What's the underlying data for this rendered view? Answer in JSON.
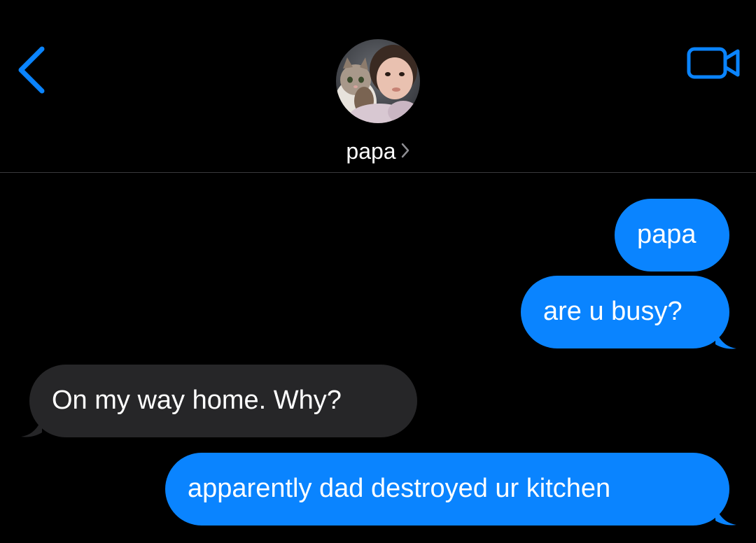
{
  "header": {
    "contact_name": "papa",
    "icons": {
      "back": "chevron-left-icon",
      "video": "video-camera-icon",
      "name_chevron": "chevron-right-icon"
    }
  },
  "messages": [
    {
      "direction": "sent",
      "text": "papa"
    },
    {
      "direction": "sent",
      "text": "are u busy?"
    },
    {
      "direction": "received",
      "text": "On my way home. Why?"
    },
    {
      "direction": "sent",
      "text": "apparently dad destroyed ur kitchen"
    }
  ],
  "colors": {
    "accent": "#0a84ff",
    "sent_bubble": "#0a84ff",
    "received_bubble": "#262628",
    "background": "#000000"
  }
}
